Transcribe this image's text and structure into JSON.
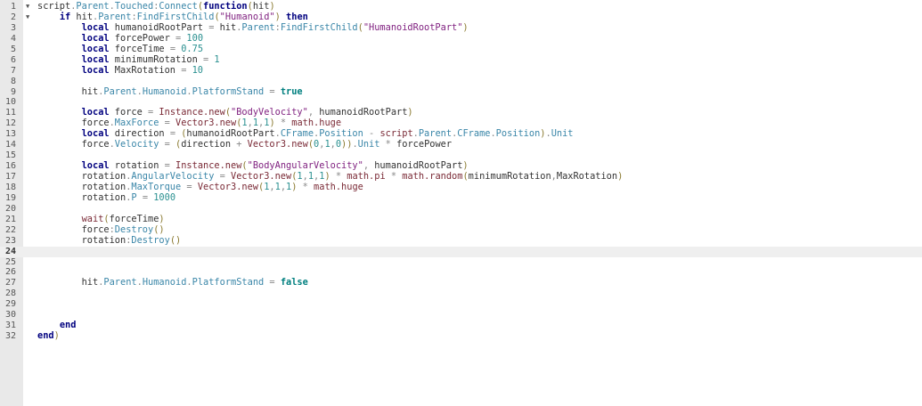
{
  "editor": {
    "current_line": 24,
    "fold_markers": {
      "1": "collapse-icon",
      "2": "collapse-icon"
    },
    "lines": [
      [
        [
          "t",
          "script"
        ],
        [
          "o",
          "."
        ],
        [
          "p",
          "Parent"
        ],
        [
          "o",
          "."
        ],
        [
          "p",
          "Touched"
        ],
        [
          "o",
          ":"
        ],
        [
          "p",
          "Connect"
        ],
        [
          "br",
          "("
        ],
        [
          "k",
          "function"
        ],
        [
          "br",
          "("
        ],
        [
          "t",
          "hit"
        ],
        [
          "br",
          ")"
        ]
      ],
      [
        [
          "t",
          "    "
        ],
        [
          "k",
          "if"
        ],
        [
          "t",
          " hit"
        ],
        [
          "o",
          "."
        ],
        [
          "p",
          "Parent"
        ],
        [
          "o",
          ":"
        ],
        [
          "p",
          "FindFirstChild"
        ],
        [
          "br",
          "("
        ],
        [
          "s",
          "\"Humanoid\""
        ],
        [
          "br",
          ")"
        ],
        [
          "t",
          " "
        ],
        [
          "k",
          "then"
        ]
      ],
      [
        [
          "t",
          "        "
        ],
        [
          "k",
          "local"
        ],
        [
          "t",
          " humanoidRootPart "
        ],
        [
          "o",
          "="
        ],
        [
          "t",
          " hit"
        ],
        [
          "o",
          "."
        ],
        [
          "p",
          "Parent"
        ],
        [
          "o",
          ":"
        ],
        [
          "p",
          "FindFirstChild"
        ],
        [
          "br",
          "("
        ],
        [
          "s",
          "\"HumanoidRootPart\""
        ],
        [
          "br",
          ")"
        ]
      ],
      [
        [
          "t",
          "        "
        ],
        [
          "k",
          "local"
        ],
        [
          "t",
          " forcePower "
        ],
        [
          "o",
          "="
        ],
        [
          "t",
          " "
        ],
        [
          "n",
          "100"
        ]
      ],
      [
        [
          "t",
          "        "
        ],
        [
          "k",
          "local"
        ],
        [
          "t",
          " forceTime "
        ],
        [
          "o",
          "="
        ],
        [
          "t",
          " "
        ],
        [
          "n",
          "0.75"
        ]
      ],
      [
        [
          "t",
          "        "
        ],
        [
          "k",
          "local"
        ],
        [
          "t",
          " minimumRotation "
        ],
        [
          "o",
          "="
        ],
        [
          "t",
          " "
        ],
        [
          "n",
          "1"
        ]
      ],
      [
        [
          "t",
          "        "
        ],
        [
          "k",
          "local"
        ],
        [
          "t",
          " MaxRotation "
        ],
        [
          "o",
          "="
        ],
        [
          "t",
          " "
        ],
        [
          "n",
          "10"
        ]
      ],
      [],
      [
        [
          "t",
          "        hit"
        ],
        [
          "o",
          "."
        ],
        [
          "p",
          "Parent"
        ],
        [
          "o",
          "."
        ],
        [
          "p",
          "Humanoid"
        ],
        [
          "o",
          "."
        ],
        [
          "p",
          "PlatformStand"
        ],
        [
          "t",
          " "
        ],
        [
          "o",
          "="
        ],
        [
          "t",
          " "
        ],
        [
          "b",
          "true"
        ]
      ],
      [],
      [
        [
          "t",
          "        "
        ],
        [
          "k",
          "local"
        ],
        [
          "t",
          " force "
        ],
        [
          "o",
          "="
        ],
        [
          "t",
          " "
        ],
        [
          "g",
          "Instance.new"
        ],
        [
          "br",
          "("
        ],
        [
          "s",
          "\"BodyVelocity\""
        ],
        [
          "o",
          ","
        ],
        [
          "t",
          " humanoidRootPart"
        ],
        [
          "br",
          ")"
        ]
      ],
      [
        [
          "t",
          "        force"
        ],
        [
          "o",
          "."
        ],
        [
          "p",
          "MaxForce"
        ],
        [
          "t",
          " "
        ],
        [
          "o",
          "="
        ],
        [
          "t",
          " "
        ],
        [
          "g",
          "Vector3.new"
        ],
        [
          "br",
          "("
        ],
        [
          "n",
          "1"
        ],
        [
          "o",
          ","
        ],
        [
          "n",
          "1"
        ],
        [
          "o",
          ","
        ],
        [
          "n",
          "1"
        ],
        [
          "br",
          ")"
        ],
        [
          "t",
          " "
        ],
        [
          "o",
          "*"
        ],
        [
          "t",
          " "
        ],
        [
          "g",
          "math.huge"
        ]
      ],
      [
        [
          "t",
          "        "
        ],
        [
          "k",
          "local"
        ],
        [
          "t",
          " direction "
        ],
        [
          "o",
          "="
        ],
        [
          "t",
          " "
        ],
        [
          "br",
          "("
        ],
        [
          "t",
          "humanoidRootPart"
        ],
        [
          "o",
          "."
        ],
        [
          "p",
          "CFrame"
        ],
        [
          "o",
          "."
        ],
        [
          "p",
          "Position"
        ],
        [
          "t",
          " "
        ],
        [
          "o",
          "-"
        ],
        [
          "t",
          " "
        ],
        [
          "g",
          "script"
        ],
        [
          "o",
          "."
        ],
        [
          "p",
          "Parent"
        ],
        [
          "o",
          "."
        ],
        [
          "p",
          "CFrame"
        ],
        [
          "o",
          "."
        ],
        [
          "p",
          "Position"
        ],
        [
          "br",
          ")"
        ],
        [
          "o",
          "."
        ],
        [
          "p",
          "Unit"
        ]
      ],
      [
        [
          "t",
          "        force"
        ],
        [
          "o",
          "."
        ],
        [
          "p",
          "Velocity"
        ],
        [
          "t",
          " "
        ],
        [
          "o",
          "="
        ],
        [
          "t",
          " "
        ],
        [
          "br",
          "("
        ],
        [
          "t",
          "direction "
        ],
        [
          "o",
          "+"
        ],
        [
          "t",
          " "
        ],
        [
          "g",
          "Vector3.new"
        ],
        [
          "br",
          "("
        ],
        [
          "n",
          "0"
        ],
        [
          "o",
          ","
        ],
        [
          "n",
          "1"
        ],
        [
          "o",
          ","
        ],
        [
          "n",
          "0"
        ],
        [
          "br",
          "))"
        ],
        [
          "o",
          "."
        ],
        [
          "p",
          "Unit"
        ],
        [
          "t",
          " "
        ],
        [
          "o",
          "*"
        ],
        [
          "t",
          " forcePower"
        ]
      ],
      [],
      [
        [
          "t",
          "        "
        ],
        [
          "k",
          "local"
        ],
        [
          "t",
          " rotation "
        ],
        [
          "o",
          "="
        ],
        [
          "t",
          " "
        ],
        [
          "g",
          "Instance.new"
        ],
        [
          "br",
          "("
        ],
        [
          "s",
          "\"BodyAngularVelocity\""
        ],
        [
          "o",
          ","
        ],
        [
          "t",
          " humanoidRootPart"
        ],
        [
          "br",
          ")"
        ]
      ],
      [
        [
          "t",
          "        rotation"
        ],
        [
          "o",
          "."
        ],
        [
          "p",
          "AngularVelocity"
        ],
        [
          "t",
          " "
        ],
        [
          "o",
          "="
        ],
        [
          "t",
          " "
        ],
        [
          "g",
          "Vector3.new"
        ],
        [
          "br",
          "("
        ],
        [
          "n",
          "1"
        ],
        [
          "o",
          ","
        ],
        [
          "n",
          "1"
        ],
        [
          "o",
          ","
        ],
        [
          "n",
          "1"
        ],
        [
          "br",
          ")"
        ],
        [
          "t",
          " "
        ],
        [
          "o",
          "*"
        ],
        [
          "t",
          " "
        ],
        [
          "g",
          "math.pi"
        ],
        [
          "t",
          " "
        ],
        [
          "o",
          "*"
        ],
        [
          "t",
          " "
        ],
        [
          "g",
          "math.random"
        ],
        [
          "br",
          "("
        ],
        [
          "t",
          "minimumRotation"
        ],
        [
          "o",
          ","
        ],
        [
          "t",
          "MaxRotation"
        ],
        [
          "br",
          ")"
        ]
      ],
      [
        [
          "t",
          "        rotation"
        ],
        [
          "o",
          "."
        ],
        [
          "p",
          "MaxTorque"
        ],
        [
          "t",
          " "
        ],
        [
          "o",
          "="
        ],
        [
          "t",
          " "
        ],
        [
          "g",
          "Vector3.new"
        ],
        [
          "br",
          "("
        ],
        [
          "n",
          "1"
        ],
        [
          "o",
          ","
        ],
        [
          "n",
          "1"
        ],
        [
          "o",
          ","
        ],
        [
          "n",
          "1"
        ],
        [
          "br",
          ")"
        ],
        [
          "t",
          " "
        ],
        [
          "o",
          "*"
        ],
        [
          "t",
          " "
        ],
        [
          "g",
          "math.huge"
        ]
      ],
      [
        [
          "t",
          "        rotation"
        ],
        [
          "o",
          "."
        ],
        [
          "p",
          "P"
        ],
        [
          "t",
          " "
        ],
        [
          "o",
          "="
        ],
        [
          "t",
          " "
        ],
        [
          "n",
          "1000"
        ]
      ],
      [],
      [
        [
          "t",
          "        "
        ],
        [
          "g",
          "wait"
        ],
        [
          "br",
          "("
        ],
        [
          "t",
          "forceTime"
        ],
        [
          "br",
          ")"
        ]
      ],
      [
        [
          "t",
          "        force"
        ],
        [
          "o",
          ":"
        ],
        [
          "p",
          "Destroy"
        ],
        [
          "br",
          "()"
        ]
      ],
      [
        [
          "t",
          "        rotation"
        ],
        [
          "o",
          ":"
        ],
        [
          "p",
          "Destroy"
        ],
        [
          "br",
          "()"
        ]
      ],
      [],
      [],
      [],
      [
        [
          "t",
          "        hit"
        ],
        [
          "o",
          "."
        ],
        [
          "p",
          "Parent"
        ],
        [
          "o",
          "."
        ],
        [
          "p",
          "Humanoid"
        ],
        [
          "o",
          "."
        ],
        [
          "p",
          "PlatformStand"
        ],
        [
          "t",
          " "
        ],
        [
          "o",
          "="
        ],
        [
          "t",
          " "
        ],
        [
          "b",
          "false"
        ]
      ],
      [],
      [],
      [],
      [
        [
          "t",
          "    "
        ],
        [
          "k",
          "end"
        ]
      ],
      [
        [
          "k",
          "end"
        ],
        [
          "br",
          ")"
        ]
      ]
    ]
  }
}
